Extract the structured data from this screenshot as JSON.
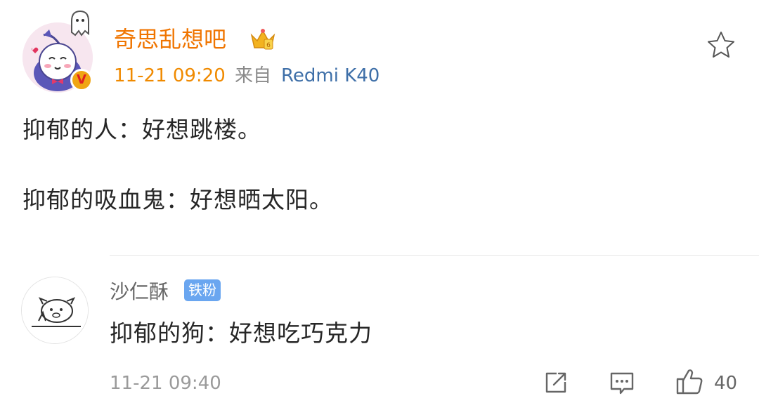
{
  "post": {
    "author": "奇思乱想吧",
    "verified_badge": "V",
    "time": "11-21 09:20",
    "source_prefix": "来自",
    "source_device": "Redmi K40",
    "lines": [
      "抑郁的人：好想跳楼。",
      "抑郁的吸血鬼：好想晒太阳。"
    ]
  },
  "comment": {
    "author": "沙仁酥",
    "badge": "铁粉",
    "text": "抑郁的狗：好想吃巧克力",
    "time": "11-21 09:40",
    "likes": "40"
  },
  "colors": {
    "author": "#f07500",
    "time": "#f08a00",
    "source_device": "#3e6fa8",
    "badge_bg": "#6aa6f0"
  },
  "icons": {
    "favorite": "star-icon",
    "share": "share-icon",
    "reply": "comment-icon",
    "like": "thumbs-up-icon"
  }
}
